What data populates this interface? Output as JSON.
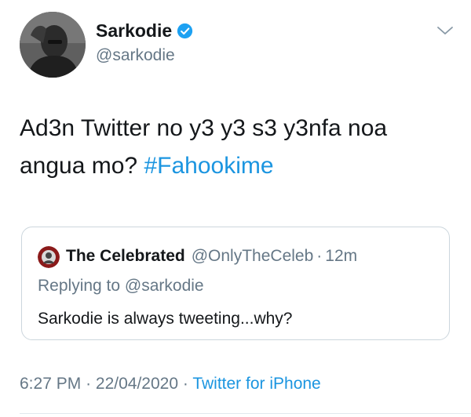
{
  "tweet": {
    "author_name": "Sarkodie",
    "author_handle": "@sarkodie",
    "text": "Ad3n Twitter no y3 y3 s3 y3nfa noa angua mo?",
    "hashtag": "#Fahookime",
    "time": "6:27 PM",
    "separator": "·",
    "date": "22/04/2020",
    "source": "Twitter for iPhone"
  },
  "quoted": {
    "author_name": "The Celebrated",
    "author_handle": "@OnlyTheCeleb",
    "separator": "·",
    "time_ago": "12m",
    "replying_to": "Replying to @sarkodie",
    "text": "Sarkodie is always tweeting...why?"
  },
  "colors": {
    "link": "#1b95e0",
    "secondary_text": "#657786",
    "primary_text": "#14171a",
    "verified_badge": "#1da1f2"
  },
  "icons": [
    "avatar-photo",
    "verified-badge-icon",
    "chevron-down-icon"
  ]
}
